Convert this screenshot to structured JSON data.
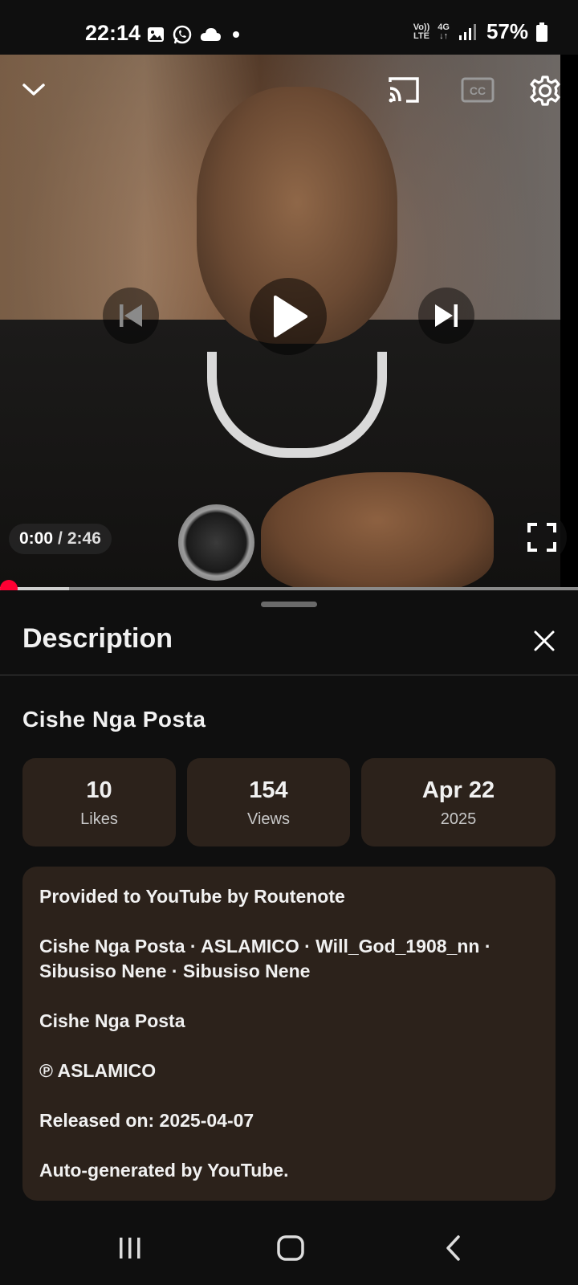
{
  "status_bar": {
    "time": "22:14",
    "network_top": "Vo))",
    "network_bottom": "LTE",
    "network_type": "4G",
    "battery": "57%",
    "icons": [
      "gallery-icon",
      "whatsapp-icon",
      "cloud-icon",
      "dot-icon",
      "signal-icon",
      "battery-icon"
    ]
  },
  "player": {
    "current_time": "0:00",
    "separator": "/",
    "duration": "2:46",
    "progress_fraction": 0.0,
    "buffer_fraction": 0.12,
    "controls": [
      "collapse-icon",
      "cast-icon",
      "captions-icon",
      "settings-icon",
      "previous-icon",
      "play-icon",
      "next-icon",
      "fullscreen-icon"
    ],
    "captions_label": "CC",
    "accent_color": "#ff0033"
  },
  "description_panel": {
    "heading": "Description",
    "video_title": "Cishe Nga Posta",
    "stats": {
      "likes_value": "10",
      "likes_label": "Likes",
      "views_value": "154",
      "views_label": "Views",
      "date_value": "Apr 22",
      "date_year": "2025"
    },
    "description_lines": {
      "line1": "Provided to YouTube by Routenote",
      "line2": "Cishe Nga Posta · ASLAMICO · Will_God_1908_nn · Sibusiso Nene · Sibusiso Nene",
      "line3": "Cishe Nga Posta",
      "line4": "℗ ASLAMICO",
      "line5": "Released on: 2025-04-07",
      "line6": "Auto-generated by YouTube."
    }
  },
  "nav_bar": {
    "buttons": [
      "recents-icon",
      "home-icon",
      "back-icon"
    ]
  }
}
